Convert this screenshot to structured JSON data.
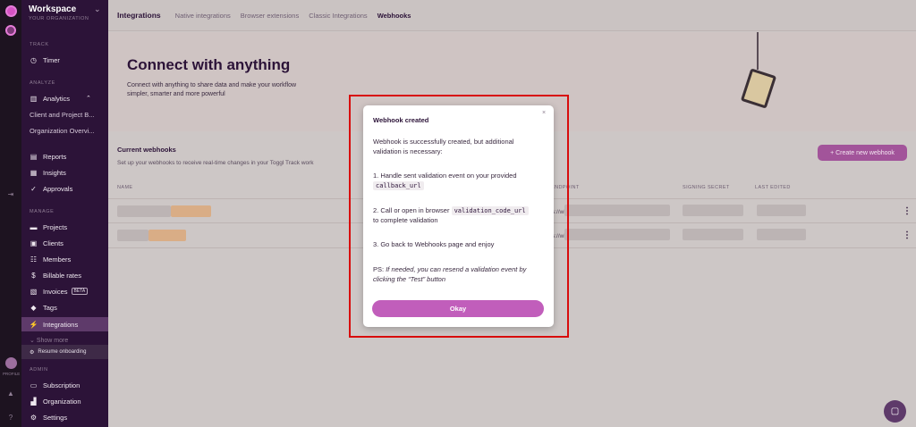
{
  "workspace": {
    "title": "Workspace",
    "subtitle": "YOUR ORGANIZATION"
  },
  "sidebar": {
    "sections": {
      "track": "TRACK",
      "analyze": "ANALYZE",
      "manage": "MANAGE",
      "admin": "ADMIN"
    },
    "timer": "Timer",
    "analytics": "Analytics",
    "analytics_sub": [
      "Client and Project B...",
      "Organization Overvi..."
    ],
    "reports": "Reports",
    "insights": "Insights",
    "approvals": "Approvals",
    "projects": "Projects",
    "clients": "Clients",
    "members": "Members",
    "billable": "Billable rates",
    "invoices": "Invoices",
    "beta": "BETA",
    "tags": "Tags",
    "integrations": "Integrations",
    "show_more": "Show more",
    "resume": "Resume onboarding",
    "subscription": "Subscription",
    "organization": "Organization",
    "settings": "Settings",
    "profile": "PROFILE"
  },
  "topbar": {
    "title": "Integrations",
    "tabs": [
      "Native integrations",
      "Browser extensions",
      "Classic Integrations",
      "Webhooks"
    ]
  },
  "hero": {
    "title": "Connect with anything",
    "description": "Connect with anything to share data and make your workflow simpler, smarter and more powerful"
  },
  "webhooks": {
    "title": "Current webhooks",
    "description": "Set up your webhooks to receive real-time changes in your Toggl Track work",
    "create_label": "+ Create new webhook",
    "columns": {
      "name": "NAME",
      "endpoint": "ENDPOINT",
      "secret": "SIGNING SECRET",
      "edited": "LAST EDITED"
    },
    "rows": [
      {
        "endpoint_start": "s://wi"
      },
      {
        "endpoint_start": "s://wi"
      }
    ]
  },
  "modal": {
    "title": "Webhook created",
    "intro": "Webhook is successfully created, but additional validation is necessary:",
    "step1": "1. Handle sent validation event on your provided",
    "step1_code": "callback_url",
    "step2_pre": "2. Call or open in browser",
    "step2_code": "validation_code_url",
    "step2_post": "to complete validation",
    "step3": "3. Go back to Webhooks page and enjoy",
    "ps_label": "PS:",
    "ps_text": "If needed, you can resend a validation event by clicking the “Test” button",
    "okay": "Okay",
    "close": "×"
  },
  "colors": {
    "accent": "#c15ebb",
    "sidebar": "#2c1338",
    "highlight": "#d80c0c"
  }
}
